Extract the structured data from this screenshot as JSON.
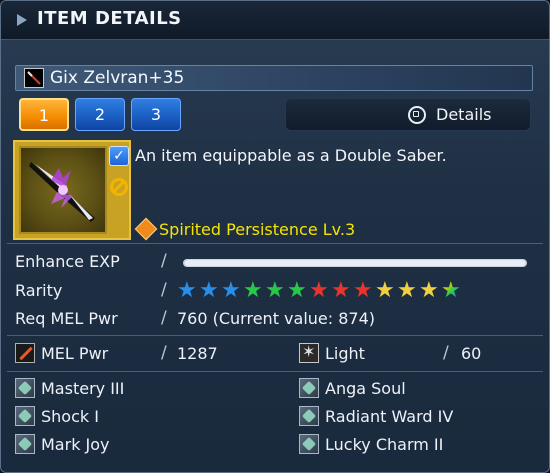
{
  "window": {
    "title": "ITEM DETAILS",
    "subtitle_dots": "••• ••"
  },
  "item": {
    "name": "Gix Zelvran+35",
    "description": "An item equippable as a Double Saber.",
    "ability": "Spirited Persistence Lv.3"
  },
  "tabs": [
    {
      "label": "1",
      "active": true
    },
    {
      "label": "2",
      "active": false
    },
    {
      "label": "3",
      "active": false
    }
  ],
  "details_button": {
    "label": "Details"
  },
  "rows": {
    "enhance_exp": {
      "label": "Enhance EXP",
      "progress": 1.0
    },
    "rarity": {
      "label": "Rarity",
      "stars": 13
    },
    "req": {
      "label": "Req MEL Pwr",
      "value": "760 (Current value: 874)"
    }
  },
  "stats": {
    "mel": {
      "label": "MEL Pwr",
      "value": "1287",
      "icon": "sword-icon"
    },
    "light": {
      "label": "Light",
      "value": "60",
      "icon": "light-element-icon"
    }
  },
  "augments": {
    "left": [
      "Mastery III",
      "Shock I",
      "Mark Joy"
    ],
    "right": [
      "Anga Soul",
      "Radiant Ward IV",
      "Lucky Charm II"
    ]
  },
  "colors": {
    "star_colors": [
      "#2a8fe8",
      "#2a8fe8",
      "#2a8fe8",
      "#28c84a",
      "#28c84a",
      "#28c84a",
      "#e8342c",
      "#e8342c",
      "#e8342c",
      "#f0d040",
      "#f0d040",
      "#f0d040",
      "rainbow"
    ],
    "ability_color": "#f5e400",
    "active_tab": "#f48c00",
    "inactive_tab": "#1a5cc0"
  }
}
